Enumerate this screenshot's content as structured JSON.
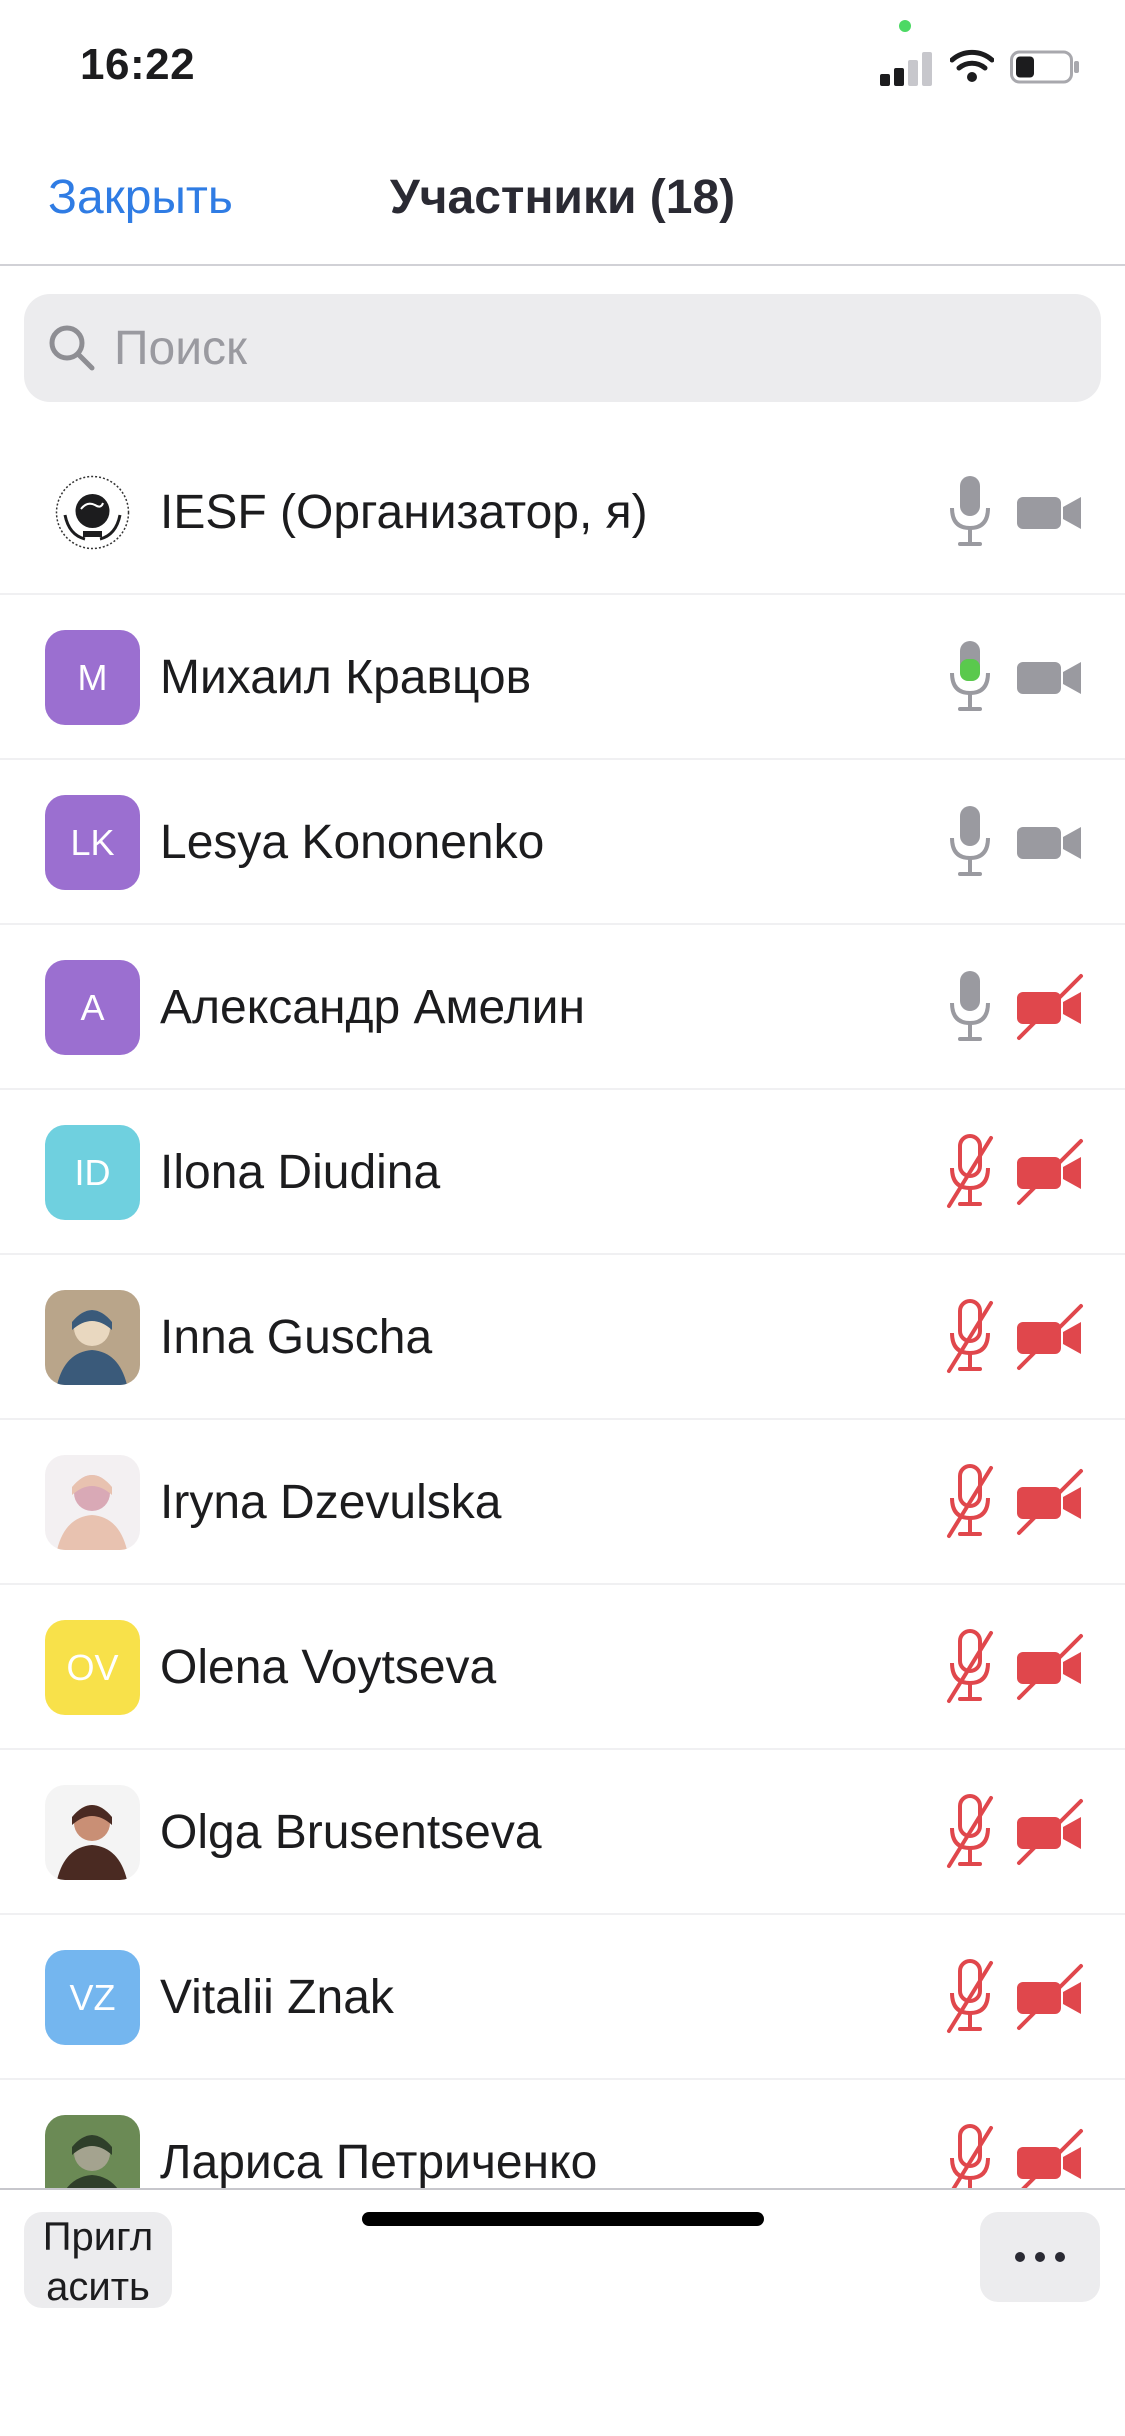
{
  "status_bar": {
    "time": "16:22"
  },
  "header": {
    "close_label": "Закрыть",
    "title": "Участники (18)"
  },
  "search": {
    "placeholder": "Поиск",
    "value": ""
  },
  "participants": [
    {
      "name": "IESF (Организатор, я)",
      "avatar": "",
      "avatar_type": "logo",
      "mic": "on",
      "camera": "on"
    },
    {
      "name": "Михаил Кравцов",
      "avatar": "M",
      "avatar_color": "#9b6fd0",
      "mic": "speaking",
      "camera": "on"
    },
    {
      "name": "Lesya Kononenko",
      "avatar": "LK",
      "avatar_color": "#9b6fd0",
      "mic": "on",
      "camera": "on"
    },
    {
      "name": "Александр Амелин",
      "avatar": "A",
      "avatar_color": "#9b6fd0",
      "mic": "on",
      "camera": "off"
    },
    {
      "name": "Ilona Diudina",
      "avatar": "ID",
      "avatar_color": "#6fd0df",
      "mic": "off",
      "camera": "off"
    },
    {
      "name": "Inna Guscha",
      "avatar": "",
      "avatar_type": "photo",
      "mic": "off",
      "camera": "off"
    },
    {
      "name": "Iryna Dzevulska",
      "avatar": "",
      "avatar_type": "photo",
      "mic": "off",
      "camera": "off"
    },
    {
      "name": "Olena Voytseva",
      "avatar": "OV",
      "avatar_color": "#f8e14a",
      "mic": "off",
      "camera": "off"
    },
    {
      "name": "Olga Brusentseva",
      "avatar": "",
      "avatar_type": "photo",
      "mic": "off",
      "camera": "off"
    },
    {
      "name": "Vitalii Znak",
      "avatar": "VZ",
      "avatar_color": "#74b6ef",
      "mic": "off",
      "camera": "off"
    },
    {
      "name": "Лариса Петриченко",
      "avatar": "",
      "avatar_type": "photo",
      "mic": "off",
      "camera": "off"
    }
  ],
  "bottom_bar": {
    "invite_label": "Пригл асить"
  },
  "colors": {
    "accent": "#2f7ce4",
    "muted_red": "#e0474c",
    "speaking_green": "#5ac94d",
    "icon_gray": "#9a9aa0"
  }
}
